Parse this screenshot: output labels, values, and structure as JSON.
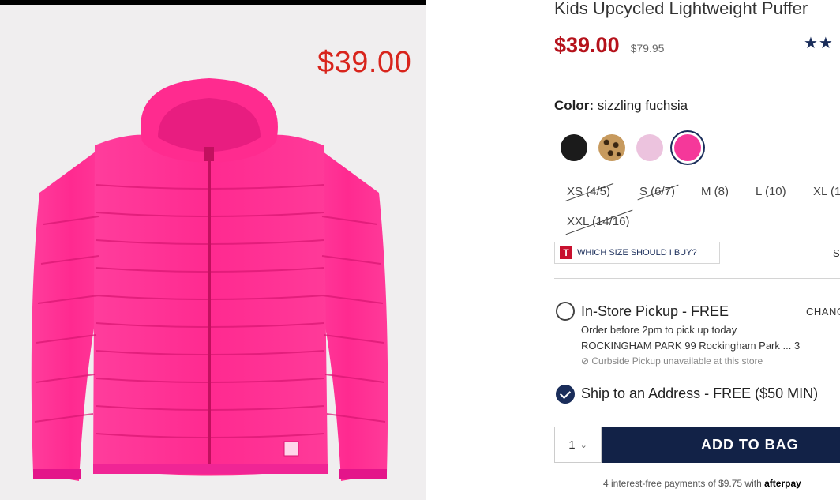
{
  "product": {
    "title": "Kids Upcycled Lightweight Puffer",
    "image_price": "$39.00",
    "price": "$39.00",
    "original_price": "$79.95",
    "rating_stars": "★★",
    "color_label": "Color:",
    "color_value": "sizzling fuchsia",
    "swatches": [
      {
        "name": "black",
        "color": "#1b1b1b"
      },
      {
        "name": "leopard",
        "color": "#c79a5e"
      },
      {
        "name": "light pink",
        "color": "#ecc3de"
      },
      {
        "name": "sizzling fuchsia",
        "color": "#f5389a",
        "selected": true
      }
    ],
    "sizes": [
      {
        "label": "XS (4/5)",
        "available": false
      },
      {
        "label": "S (6/7)",
        "available": false
      },
      {
        "label": "M (8)",
        "available": true
      },
      {
        "label": "L (10)",
        "available": true
      },
      {
        "label": "XL (1",
        "available": true
      },
      {
        "label": "XXL (14/16)",
        "available": false
      }
    ],
    "which_size": "WHICH SIZE SHOULD I BUY?",
    "size_guide": "S"
  },
  "fulfillment": {
    "pickup_title": "In-Store Pickup - FREE",
    "pickup_change": "CHANG",
    "pickup_note": "Order before 2pm to pick up today",
    "pickup_store": "ROCKINGHAM PARK 99 Rockingham Park ... 3",
    "curbside": "⊘ Curbside Pickup unavailable at this store",
    "ship_title": "Ship to an Address - FREE ($50 MIN)"
  },
  "cart": {
    "quantity": "1",
    "add_label": "ADD TO BAG",
    "afterpay_text": "4 interest-free payments of $9.75 with",
    "afterpay_brand": "afterpay"
  },
  "colors": {
    "accent_navy": "#122247",
    "sale_red": "#b5121b",
    "jacket_pink": "#ff2d93"
  }
}
